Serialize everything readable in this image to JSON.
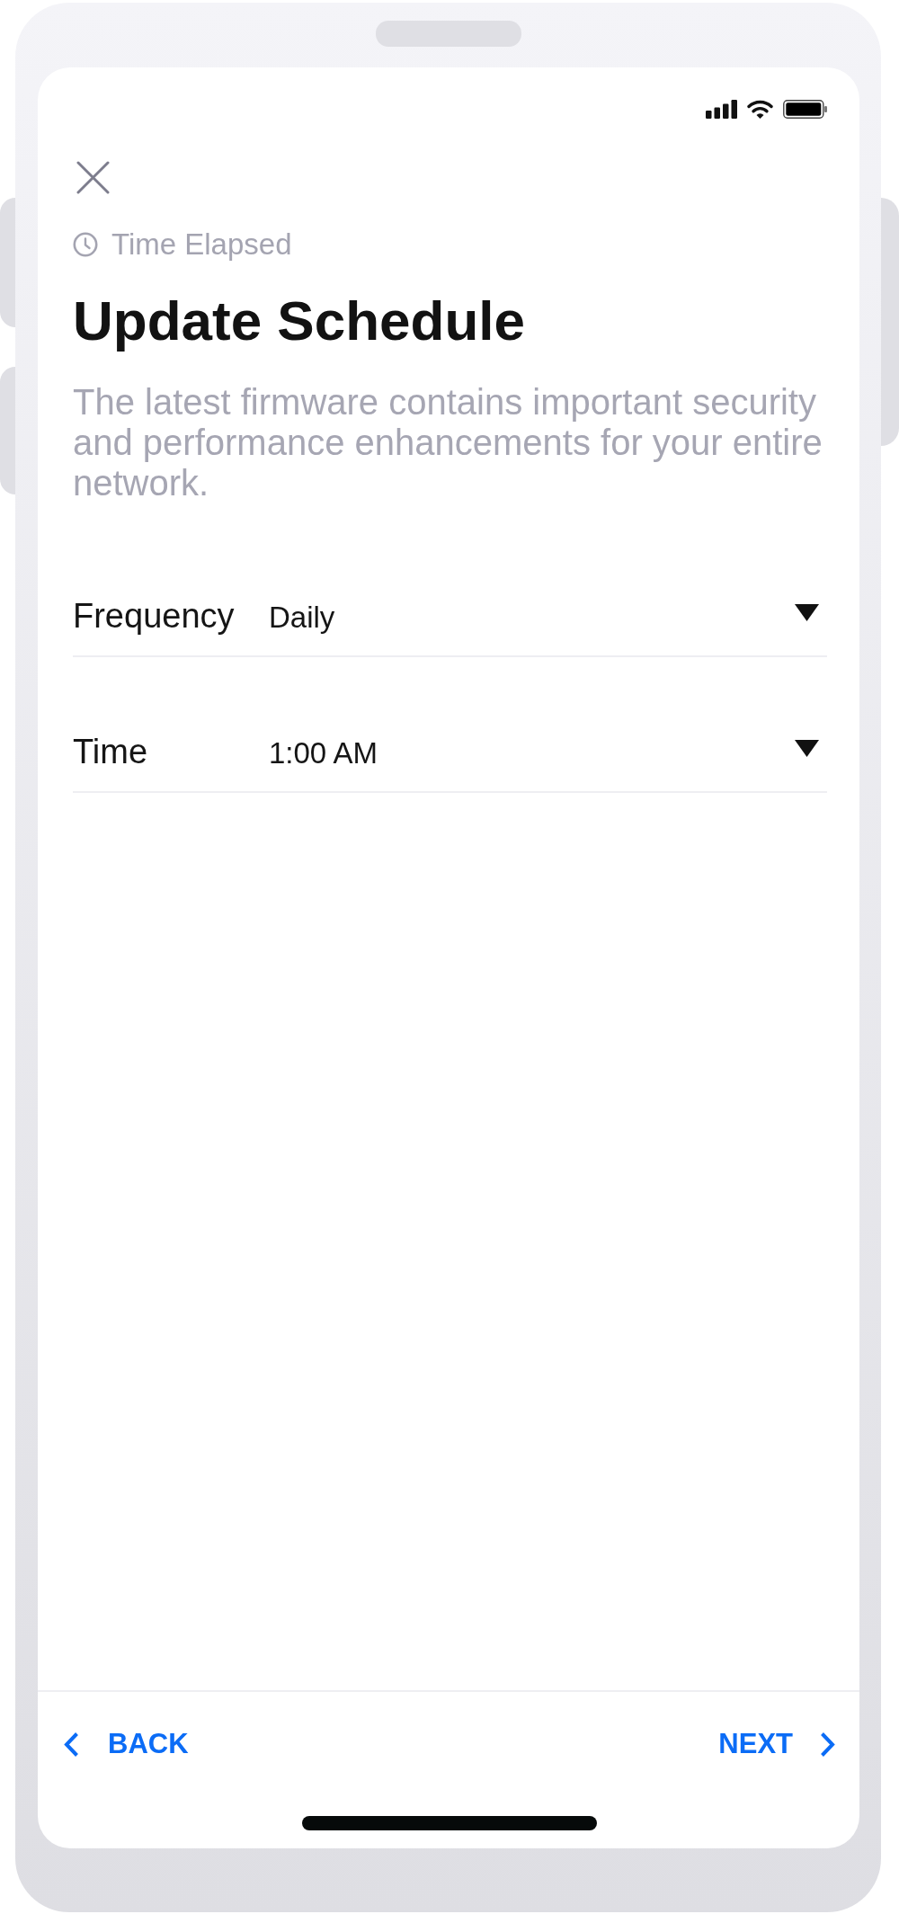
{
  "header": {
    "timer_label": "Time Elapsed",
    "title": "Update Schedule",
    "description": "The latest firmware contains important security and performance enhancements for your entire network."
  },
  "fields": [
    {
      "label": "Frequency",
      "value": "Daily"
    },
    {
      "label": "Time",
      "value": "1:00 AM"
    }
  ],
  "footer": {
    "buttons": [
      {
        "label": "BACK",
        "kind": "back"
      },
      {
        "label": "NEXT",
        "kind": "next"
      }
    ]
  }
}
